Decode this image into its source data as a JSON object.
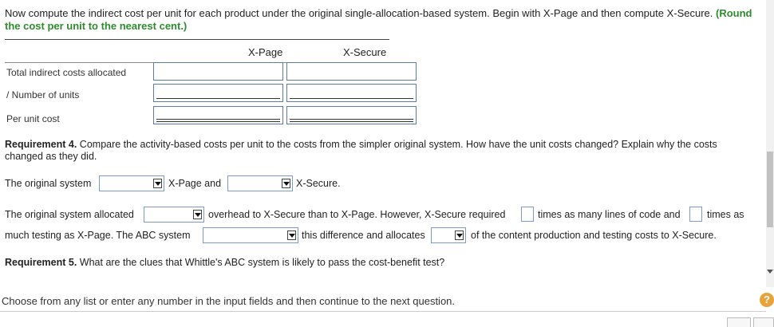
{
  "intro": {
    "text": "Now compute the indirect cost per unit for each product under the original single-allocation-based system. Begin with X-Page and then compute X-Secure.",
    "highlight": "(Round the cost per unit to the nearest cent.)"
  },
  "table": {
    "columns": [
      "X-Page",
      "X-Secure"
    ],
    "rows": [
      {
        "label": "Total indirect costs allocated"
      },
      {
        "label": "/ Number of units"
      },
      {
        "label": "Per unit cost"
      }
    ]
  },
  "req4": {
    "title": "Requirement 4.",
    "text": "Compare the activity-based costs per unit to the costs from the simpler original system. How have the unit costs changed? Explain why the costs changed as they did."
  },
  "sentence1": {
    "part1": "The original system",
    "part2": "X-Page and",
    "part3": "X-Secure."
  },
  "sentence2": {
    "part1": "The original system allocated",
    "part2": "overhead to X-Secure than to X-Page. However, X-Secure required",
    "part3": "times as many lines of code and",
    "part4": "times as",
    "part5": "much testing as X-Page. The ABC system",
    "part6": "this difference and allocates",
    "part7": "of the content production and testing costs to X-Secure."
  },
  "req5": {
    "title": "Requirement 5.",
    "text": "What are the clues that Whittle's ABC system is likely to pass the cost-benefit test?"
  },
  "footer": {
    "text": "Choose from any list or enter any number in the input fields and then continue to the next question.",
    "help": "?"
  },
  "colors": {
    "accent_green": "#2e8b2e",
    "input_border": "#5a7bb0",
    "help_orange": "#e8a23a"
  }
}
